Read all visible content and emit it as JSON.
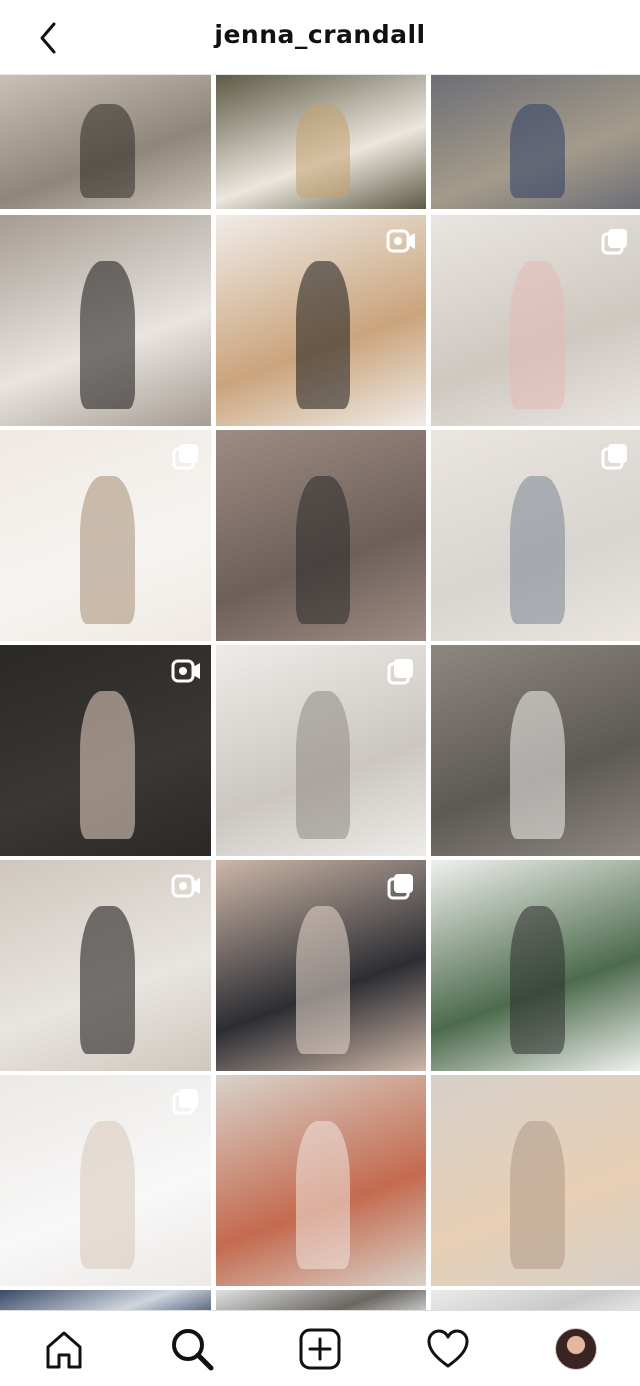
{
  "header": {
    "username": "jenna_crandall",
    "back_icon": "chevron-left-icon"
  },
  "grid": {
    "posts": [
      {
        "id": "post-1",
        "type": "photo",
        "colors": [
          "#c9c1b6",
          "#8e8679",
          "#2d2a27"
        ]
      },
      {
        "id": "post-2",
        "type": "photo",
        "colors": [
          "#5d5a45",
          "#ece7de",
          "#c4a06f"
        ]
      },
      {
        "id": "post-3",
        "type": "photo",
        "colors": [
          "#6d6e76",
          "#a49b8a",
          "#2f3f68"
        ]
      },
      {
        "id": "post-4",
        "type": "photo",
        "colors": [
          "#a59c93",
          "#e9e4e0",
          "#151515"
        ]
      },
      {
        "id": "post-5",
        "type": "video",
        "colors": [
          "#f0ece8",
          "#caa47c",
          "#1a1a1a"
        ]
      },
      {
        "id": "post-6",
        "type": "carousel",
        "colors": [
          "#e9e5e1",
          "#cfc8c1",
          "#e3b9b4"
        ]
      },
      {
        "id": "post-7",
        "type": "carousel",
        "colors": [
          "#efe9e3",
          "#f6f4f1",
          "#a68e74"
        ]
      },
      {
        "id": "post-8",
        "type": "photo",
        "colors": [
          "#9c8c83",
          "#6e5f59",
          "#2a2a2a"
        ]
      },
      {
        "id": "post-9",
        "type": "carousel",
        "colors": [
          "#eae5df",
          "#d8d4cf",
          "#7c8793"
        ]
      },
      {
        "id": "post-10",
        "type": "video",
        "colors": [
          "#2b2926",
          "#3a3734",
          "#e9d4c5"
        ]
      },
      {
        "id": "post-11",
        "type": "carousel",
        "colors": [
          "#eeece9",
          "#cbc6c0",
          "#8f8b86"
        ]
      },
      {
        "id": "post-12",
        "type": "photo",
        "colors": [
          "#8d8780",
          "#5d5953",
          "#f2f0ee"
        ]
      },
      {
        "id": "post-13",
        "type": "video",
        "colors": [
          "#cfc7bf",
          "#e8e4df",
          "#111111"
        ]
      },
      {
        "id": "post-14",
        "type": "carousel",
        "colors": [
          "#cdb7a8",
          "#2c2d33",
          "#e7d8cd"
        ]
      },
      {
        "id": "post-15",
        "type": "photo",
        "colors": [
          "#f0f0ee",
          "#4c6b4c",
          "#2e2e2e"
        ]
      },
      {
        "id": "post-16",
        "type": "carousel",
        "colors": [
          "#ece9e6",
          "#f8f8f8",
          "#d7c7b8"
        ]
      },
      {
        "id": "post-17",
        "type": "photo",
        "colors": [
          "#d8d2ca",
          "#c46a4e",
          "#f0e5de"
        ]
      },
      {
        "id": "post-18",
        "type": "photo",
        "colors": [
          "#d6d0c8",
          "#e8cfb5",
          "#b19b86"
        ]
      },
      {
        "id": "post-19",
        "type": "photo",
        "colors": [
          "#3a4a66",
          "#cfd6df",
          "#5a6b86"
        ]
      },
      {
        "id": "post-20",
        "type": "photo",
        "colors": [
          "#dfe2e4",
          "#6b6660",
          "#b7b7b7"
        ]
      },
      {
        "id": "post-21",
        "type": "photo",
        "colors": [
          "#ecebea",
          "#c9c9c9",
          "#a5a5a5"
        ]
      }
    ]
  },
  "tabbar": {
    "items": [
      {
        "name": "home",
        "icon": "home-icon"
      },
      {
        "name": "search",
        "icon": "search-icon",
        "active": true
      },
      {
        "name": "new-post",
        "icon": "plus-square-icon"
      },
      {
        "name": "activity",
        "icon": "heart-icon"
      },
      {
        "name": "profile",
        "icon": "avatar"
      }
    ]
  }
}
